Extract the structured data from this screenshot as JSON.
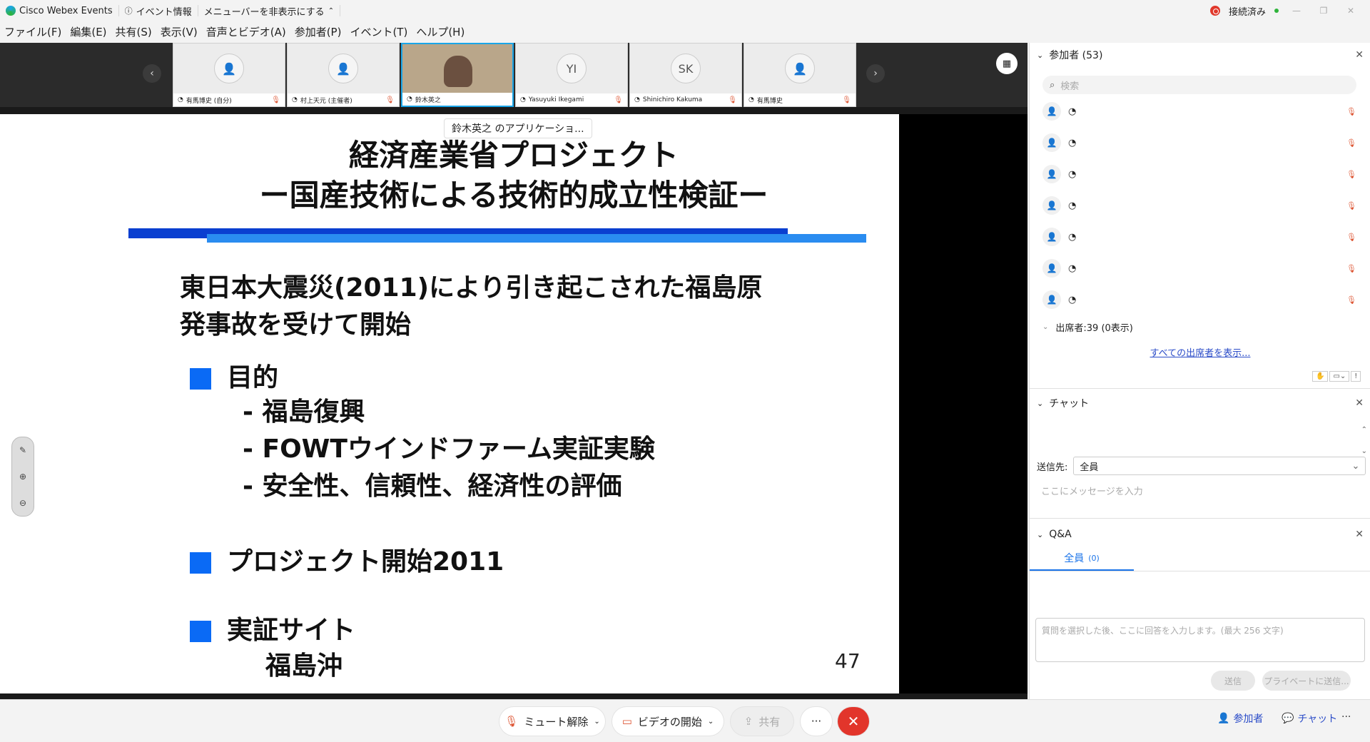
{
  "titlebar": {
    "app_name": "Cisco Webex Events",
    "event_info": "イベント情報",
    "hide_menu": "メニューバーを非表示にする",
    "status": "接続済み"
  },
  "menu": {
    "items": [
      "ファイル(F)",
      "編集(E)",
      "共有(S)",
      "表示(V)",
      "音声とビデオ(A)",
      "参加者(P)",
      "イベント(T)",
      "ヘルプ(H)"
    ]
  },
  "filmstrip": {
    "thumbs": [
      {
        "name": "有馬博史 (自分)",
        "initials": ""
      },
      {
        "name": "村上天元 (主催者)",
        "initials": ""
      },
      {
        "name": "鈴木英之",
        "initials": ""
      },
      {
        "name": "Yasuyuki Ikegami",
        "initials": "YI"
      },
      {
        "name": "Shinichiro Kakuma",
        "initials": "SK"
      },
      {
        "name": "有馬博史",
        "initials": ""
      }
    ]
  },
  "slide": {
    "sharer": "鈴木英之 のアプリケーショ...",
    "title_line1": "経済産業省プロジェクト",
    "title_line2": "ー国産技術による技術的成立性検証ー",
    "intro_line1": "東日本大震災(2011)により引き起こされた福島原",
    "intro_line2": "発事故を受けて開始",
    "purpose_heading": "目的",
    "purpose_items": [
      "- 福島復興",
      "- FOWTウインドファーム実証実験",
      "- 安全性、信頼性、経済性の評価"
    ],
    "start_heading": "プロジェクト開始2011",
    "site_heading": "実証サイト",
    "site_value": "福島沖",
    "page_number": "47"
  },
  "bottom": {
    "unmute": "ミュート解除",
    "start_video": "ビデオの開始",
    "share": "共有",
    "more": "···",
    "participants": "参加者",
    "chat": "チャット"
  },
  "panel": {
    "participants_title": "参加者 (53)",
    "search_placeholder": "検索",
    "attendees": "出席者:39 (0表示)",
    "show_all": "すべての出席者を表示...",
    "chat_title": "チャット",
    "send_to_label": "送信先:",
    "send_to_value": "全員",
    "message_placeholder": "ここにメッセージを入力",
    "qa_title": "Q&A",
    "qa_tab": "全員",
    "qa_tab_count": "(0)",
    "qa_placeholder": "質問を選択した後、ここに回答を入力します。(最大 256 文字)",
    "send_btn": "送信",
    "private_btn": "プライベートに送信..."
  }
}
